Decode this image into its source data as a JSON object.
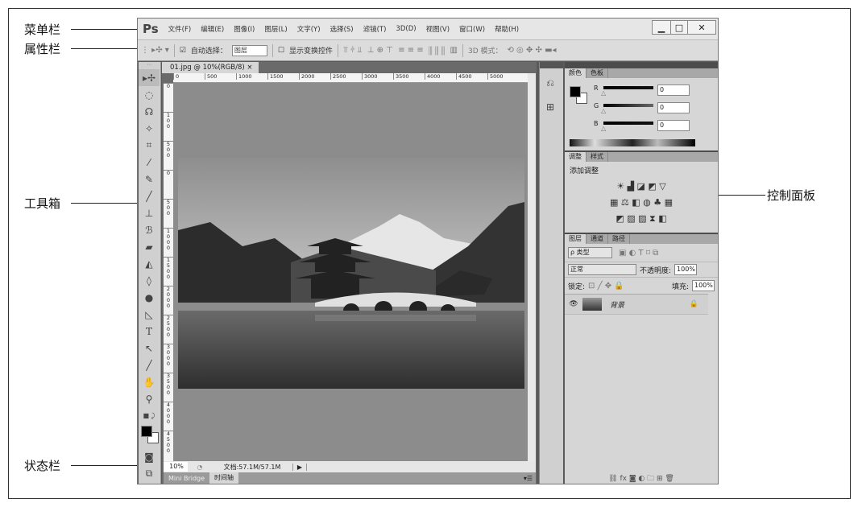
{
  "annotations": {
    "menu_bar": "菜单栏",
    "options_bar": "属性栏",
    "toolbox": "工具箱",
    "status_bar": "状态栏",
    "panels": "控制面板"
  },
  "app": {
    "logo": "Ps",
    "menu": [
      "文件(F)",
      "编辑(E)",
      "图像(I)",
      "图层(L)",
      "文字(Y)",
      "选择(S)",
      "滤镜(T)",
      "3D(D)",
      "视图(V)",
      "窗口(W)",
      "帮助(H)"
    ],
    "window_buttons": {
      "minimize": "▁",
      "maximize": "□",
      "close": "✕"
    }
  },
  "options": {
    "auto_select_label": "自动选择：",
    "auto_select_checked": true,
    "auto_select_value": "图层",
    "show_transform_label": "显示变换控件",
    "show_transform_checked": false,
    "mode_3d_label": "3D 模式："
  },
  "document": {
    "tab_title": "01.jpg @ 10%(RGB/8)",
    "tab_close": "×",
    "ruler_top": [
      "0",
      "500",
      "1000",
      "1500",
      "2000",
      "2500",
      "3000",
      "3500",
      "4000",
      "4500",
      "5000"
    ],
    "ruler_left": [
      "0",
      "1\n0\n0",
      "5\n0\n0",
      "0",
      "5\n0\n0",
      "1\n0\n0\n0",
      "1\n5\n0\n0",
      "2\n0\n0\n0",
      "2\n5\n0\n0",
      "3\n0\n0\n0",
      "3\n5\n0\n0",
      "4\n0\n0\n0",
      "4\n5\n0\n0"
    ]
  },
  "status": {
    "zoom": "10%",
    "doc_info": "文档:57.1M/57.1M",
    "arrow": "▶"
  },
  "bottom_tabs": [
    "Mini Bridge",
    "时间轴"
  ],
  "color_panel": {
    "tabs": [
      "颜色",
      "色板"
    ],
    "channels": [
      {
        "name": "R",
        "value": "0"
      },
      {
        "name": "G",
        "value": "0"
      },
      {
        "name": "B",
        "value": "0"
      }
    ]
  },
  "adjust_panel": {
    "tabs": [
      "调整",
      "样式"
    ],
    "title": "添加调整"
  },
  "layers_panel": {
    "tabs": [
      "图层",
      "通道",
      "路径"
    ],
    "filter": "ρ 类型",
    "blend_mode": "正常",
    "opacity_label": "不透明度:",
    "opacity": "100%",
    "lock_label": "锁定:",
    "fill_label": "填充:",
    "fill": "100%",
    "layers": [
      {
        "name": "背景",
        "visible": true,
        "locked": true
      }
    ]
  }
}
